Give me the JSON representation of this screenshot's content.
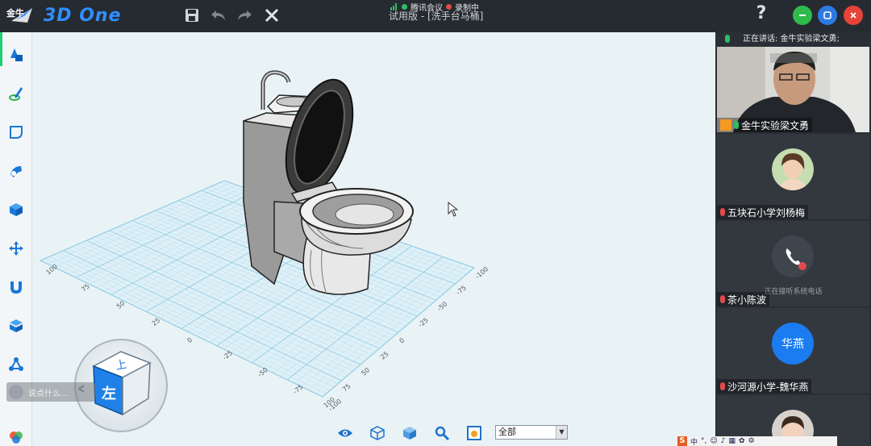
{
  "app": {
    "brand_tag": "金牛",
    "brand_name": "3D One",
    "window_title": "试用版 - [洗手台马桶]",
    "help_label": "?"
  },
  "meeting": {
    "app_label": "腾讯会议",
    "recording_label": "录制中"
  },
  "toolbar": {
    "save_icon": "save-icon",
    "undo_icon": "undo-icon",
    "redo_icon": "redo-icon",
    "delete_icon": "close-icon"
  },
  "left_tools": [
    {
      "icon": "primitive-shapes-icon"
    },
    {
      "icon": "sketch-pen-icon"
    },
    {
      "icon": "sketch-edit-icon"
    },
    {
      "icon": "special-feature-icon"
    },
    {
      "icon": "feature-modeling-icon"
    },
    {
      "icon": "move-icon"
    },
    {
      "icon": "magnet-combine-icon"
    },
    {
      "icon": "pattern-array-icon"
    },
    {
      "icon": "assembly-icon"
    },
    {
      "icon": "color-palette-icon"
    }
  ],
  "viewcube": {
    "face_label": "左",
    "top_label": "上"
  },
  "grid_ticks": {
    "x_axis": [
      "-100",
      "-75",
      "-50",
      "-25",
      "0",
      "25",
      "50",
      "75",
      "100"
    ],
    "y_axis": [
      "100",
      "75",
      "50",
      "25",
      "0",
      "-25",
      "-50",
      "-75",
      "-100"
    ]
  },
  "chat": {
    "placeholder": "说点什么..."
  },
  "viewbar": {
    "select_value": "全部",
    "icons": [
      "eye-icon",
      "wireframe-cube-icon",
      "shaded-cube-icon",
      "zoom-icon",
      "render-mode-icon"
    ]
  },
  "participants_panel": {
    "speaking_label": "正在讲话: 金牛实验梁文勇;",
    "participants": [
      {
        "name": "金牛实验梁文勇",
        "type": "video"
      },
      {
        "name": "五块石小学刘杨梅",
        "type": "photo"
      },
      {
        "name": "茶小陈波",
        "type": "phone",
        "status": "正在接听系统电话"
      },
      {
        "name": "沙河源小学-魏华燕",
        "type": "initials",
        "initials": "华燕"
      },
      {
        "name": "",
        "type": "photo"
      }
    ]
  },
  "colors": {
    "brand_blue": "#2f8fff",
    "grid_blue": "#8ccbe4",
    "green": "#2fba4c",
    "close_red": "#e6443a",
    "max_blue": "#2c7be5",
    "initials_blue": "#1a7cf0"
  },
  "ime": {
    "label": "中"
  }
}
